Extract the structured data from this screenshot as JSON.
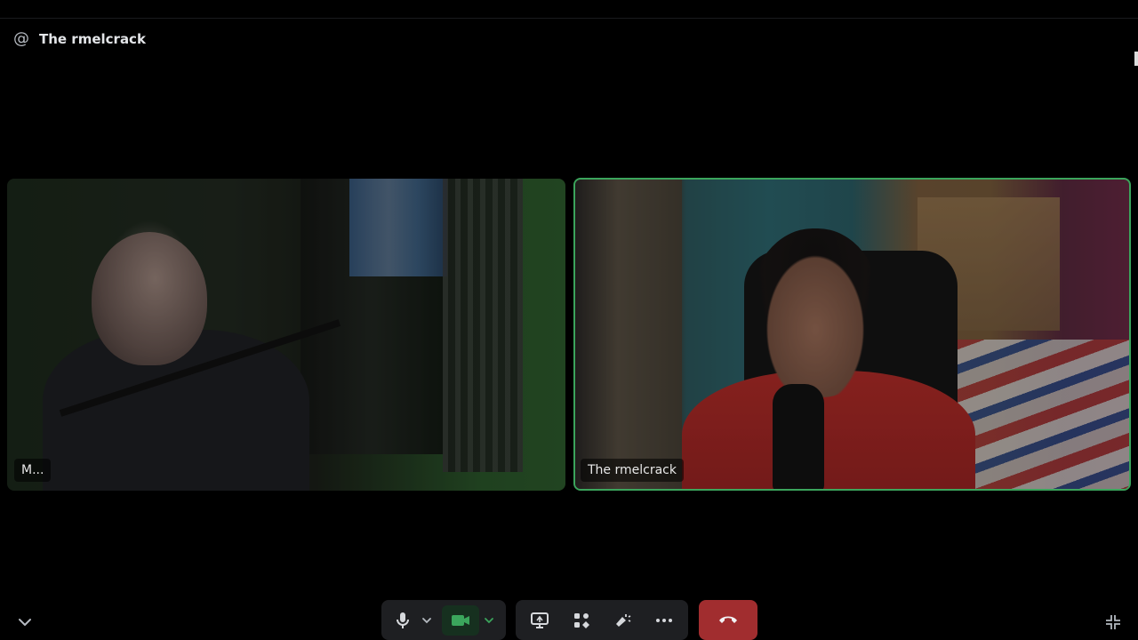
{
  "header": {
    "at_symbol": "@",
    "title": "The rmelcrack"
  },
  "participants": [
    {
      "name": "M...",
      "speaking": false
    },
    {
      "name": "The rmelcrack",
      "speaking": true
    }
  ],
  "controls": {
    "microphone_icon": "microphone-icon",
    "camera_icon": "camera-icon",
    "camera_active": true,
    "screen_share_icon": "screen-share-icon",
    "activities_icon": "activities-icon",
    "soundboard_icon": "soundboard-icon",
    "more_icon": "more-icon",
    "disconnect_icon": "hangup-icon"
  },
  "colors": {
    "speaking_border": "#3ba55c",
    "disconnect": "#a12d2f",
    "camera_active": "#3ba55c",
    "control_bg": "#1e1f22"
  }
}
